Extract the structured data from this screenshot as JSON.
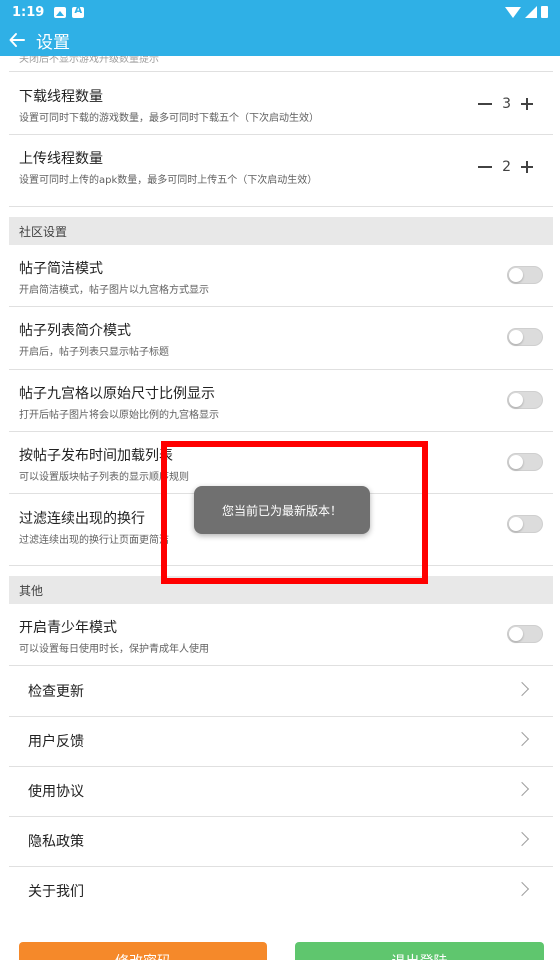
{
  "status_bar": {
    "time": "1:19"
  },
  "app_bar": {
    "title": "设置",
    "back_icon": "arrow-left-icon"
  },
  "settings": {
    "cut_hint": "关闭后不显示游戏升级数量提示",
    "download_threads": {
      "label": "下载线程数量",
      "desc": "设置可同时下载的游戏数量，最多可同时下载五个（下次启动生效）",
      "value": "3"
    },
    "upload_threads": {
      "label": "上传线程数量",
      "desc": "设置可同时上传的apk数量，最多可同时上传五个（下次启动生效）",
      "value": "2"
    },
    "community_section": "社区设置",
    "community": [
      {
        "label": "帖子简洁模式",
        "desc": "开启简洁模式，帖子图片以九宫格方式显示",
        "enabled": false
      },
      {
        "label": "帖子列表简介模式",
        "desc": "开启后，帖子列表只显示帖子标题",
        "enabled": false
      },
      {
        "label": "帖子九宫格以原始尺寸比例显示",
        "desc": "打开后帖子图片将会以原始比例的九宫格显示",
        "enabled": false
      },
      {
        "label": "按帖子发布时间加载列表",
        "desc": "可以设置版块帖子列表的显示顺序规则",
        "enabled": false
      },
      {
        "label": "过滤连续出现的换行",
        "desc": "过滤连续出现的换行让页面更简洁",
        "enabled": false
      }
    ],
    "other_section": "其他",
    "youth_mode": {
      "label": "开启青少年模式",
      "desc": "可以设置每日使用时长，保护青成年人使用",
      "enabled": false
    },
    "links": [
      "检查更新",
      "用户反馈",
      "使用协议",
      "隐私政策",
      "关于我们"
    ]
  },
  "buttons": {
    "change_password": "修改密码",
    "logout": "退出登陆"
  },
  "toast": {
    "message": "您当前已为最新版本！"
  },
  "colors": {
    "accent": "#2fb0e6",
    "annotation": "#ff0000",
    "orange": "#f5892a",
    "green": "#5fc66e"
  }
}
